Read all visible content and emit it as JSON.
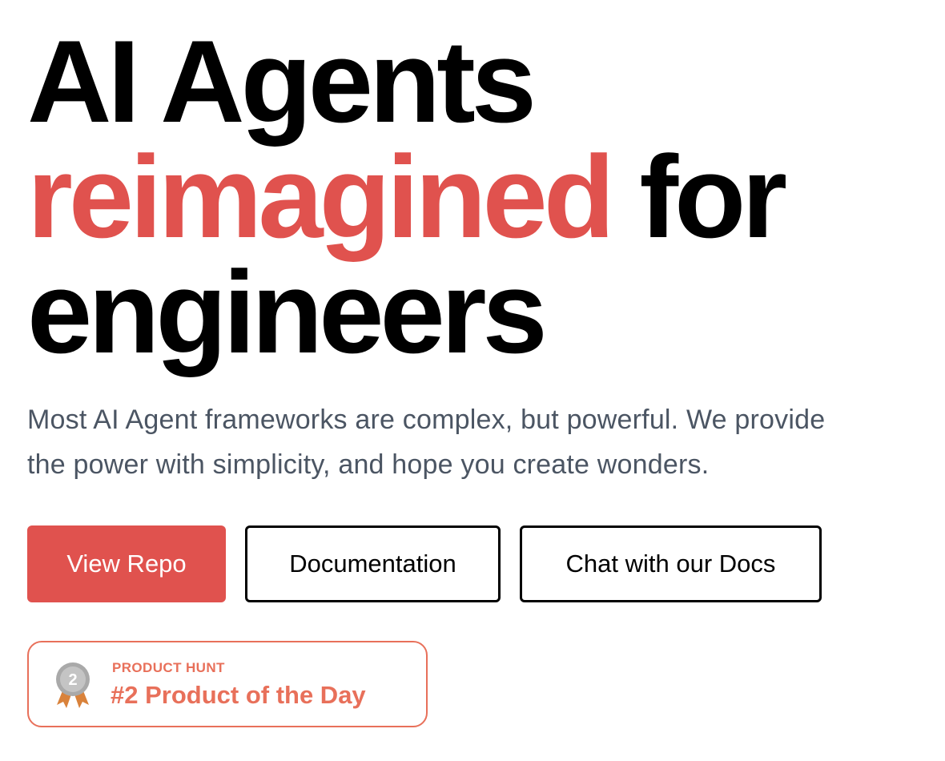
{
  "hero": {
    "headline": {
      "line1": "AI Agents",
      "accent": "reimagined",
      "line2_rest": "for",
      "line3": "engineers"
    },
    "subtitle_line1": "Most AI Agent frameworks are complex, but powerful. We provide",
    "subtitle_line2": "the power with simplicity, and hope you create wonders."
  },
  "buttons": {
    "view_repo": "View Repo",
    "documentation": "Documentation",
    "chat_docs": "Chat with our Docs"
  },
  "product_hunt": {
    "label": "PRODUCT HUNT",
    "title": "#2 Product of the Day",
    "medal_number": "2",
    "icon": "medal-icon"
  },
  "colors": {
    "accent": "#e0524e",
    "badge": "#e8705a",
    "subtitle": "#4b5563",
    "text": "#000000"
  }
}
